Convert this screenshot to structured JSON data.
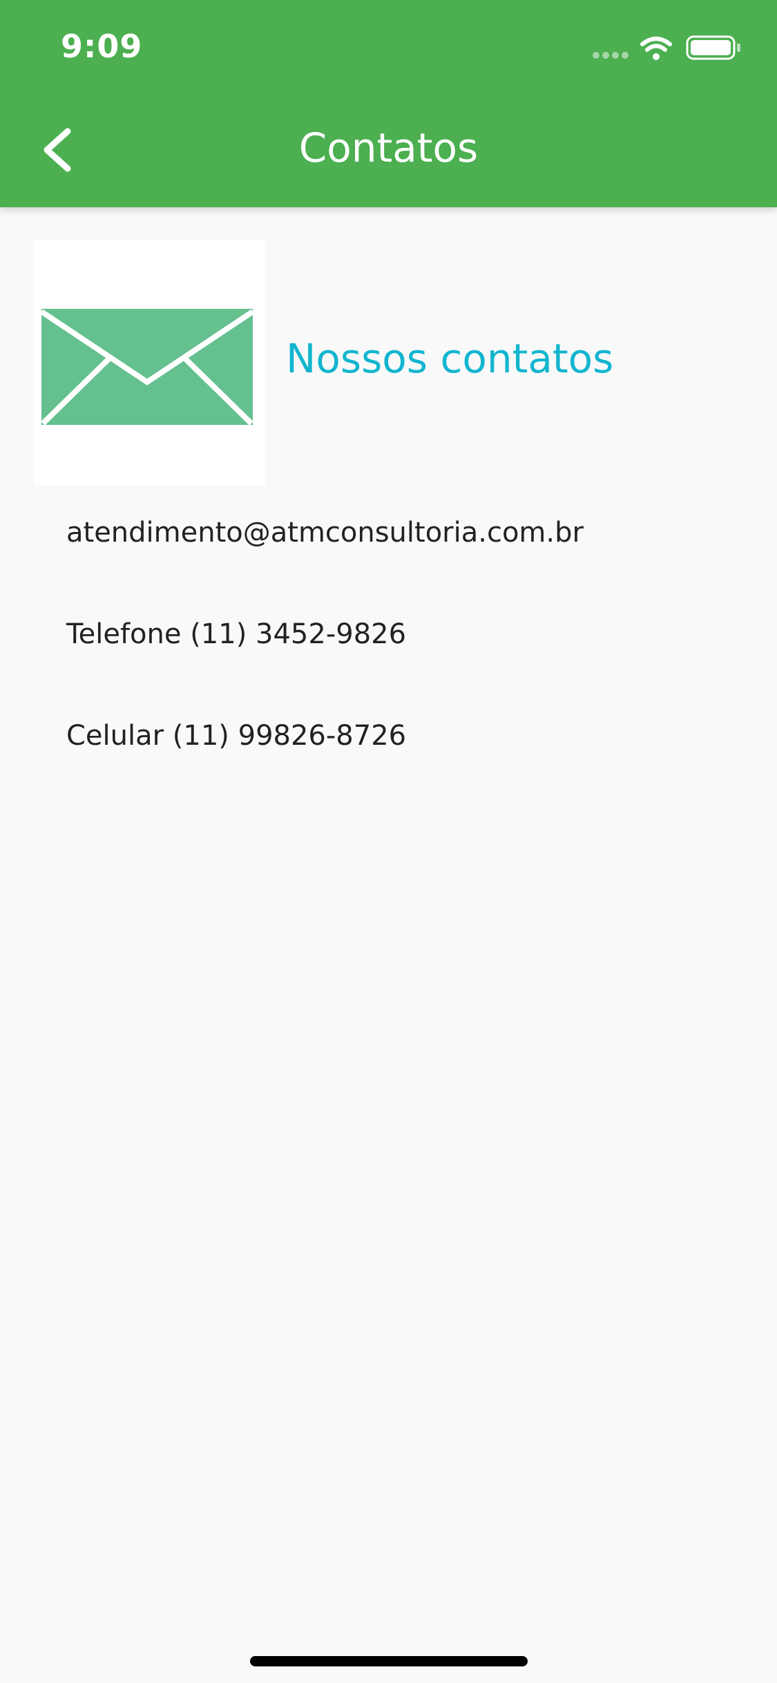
{
  "status_bar": {
    "time": "9:09"
  },
  "nav": {
    "title": "Contatos",
    "back_icon": "chevron-left-icon"
  },
  "header_card": {
    "icon": "envelope-icon",
    "title": "Nossos contatos"
  },
  "contacts": {
    "email": "atendimento@atmconsultoria.com.br",
    "telefone": "Telefone (11) 3452-9826",
    "celular": "Celular (11) 99826-8726"
  },
  "colors": {
    "app_bar": "#4caf50",
    "accent_text": "#12b5cf",
    "envelope": "#64c08e",
    "background": "#f9f9f9"
  }
}
